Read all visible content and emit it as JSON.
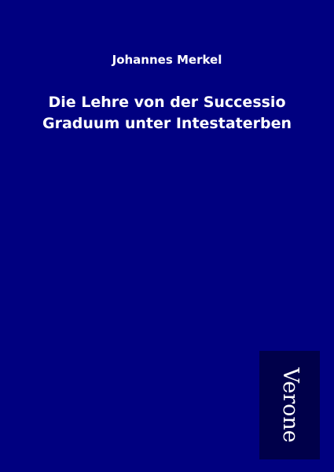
{
  "cover": {
    "author": "Johannes Merkel",
    "title_lines": [
      "Die Lehre von der Successio",
      "Graduum unter Intestaterben"
    ],
    "publisher_logo": "Verone"
  },
  "colors": {
    "background": "#000080",
    "logo_box": "#00004a",
    "text": "#ffffff"
  }
}
